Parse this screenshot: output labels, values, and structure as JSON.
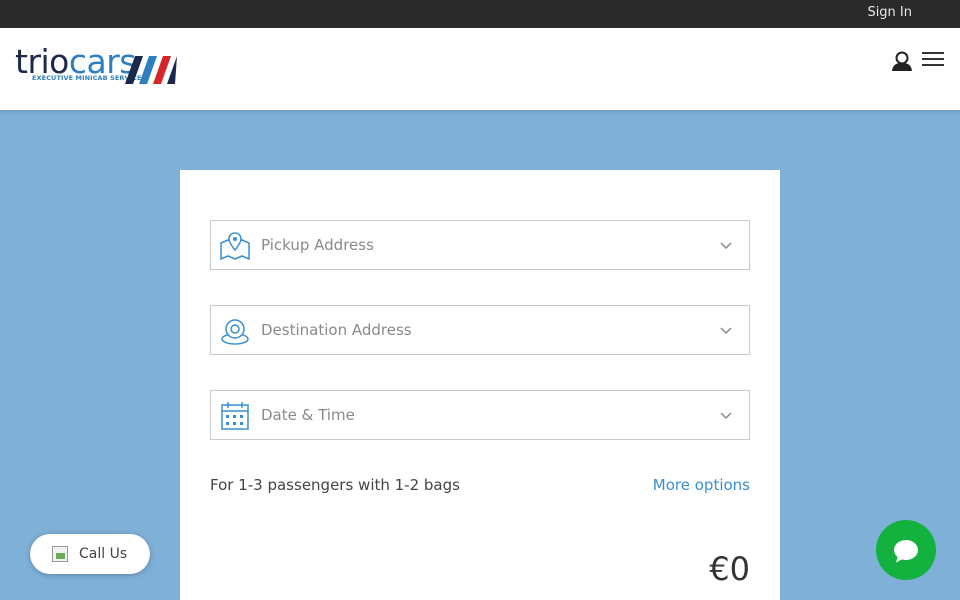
{
  "topbar": {
    "signin_label": "Sign In"
  },
  "header": {
    "logo": {
      "word_part1": "trio",
      "word_part2": "cars",
      "tagline": "EXECUTIVE MINICAB SERVICE"
    },
    "icons": {
      "user": "user-icon",
      "menu": "hamburger-menu-icon"
    }
  },
  "booking": {
    "pickup_placeholder": "Pickup Address",
    "destination_placeholder": "Destination Address",
    "datetime_placeholder": "Date & Time",
    "passengers_text": "For 1-3 passengers with 1-2 bags",
    "more_options_label": "More options",
    "price": "€0"
  },
  "call_us": {
    "label": "Call Us"
  },
  "chat": {
    "icon": "chat-bubble-icon"
  },
  "colors": {
    "page_bg": "#7fb0d8",
    "topbar_bg": "#2a2a2a",
    "accent_blue": "#3a8fd0",
    "chat_green": "#13b13e"
  }
}
